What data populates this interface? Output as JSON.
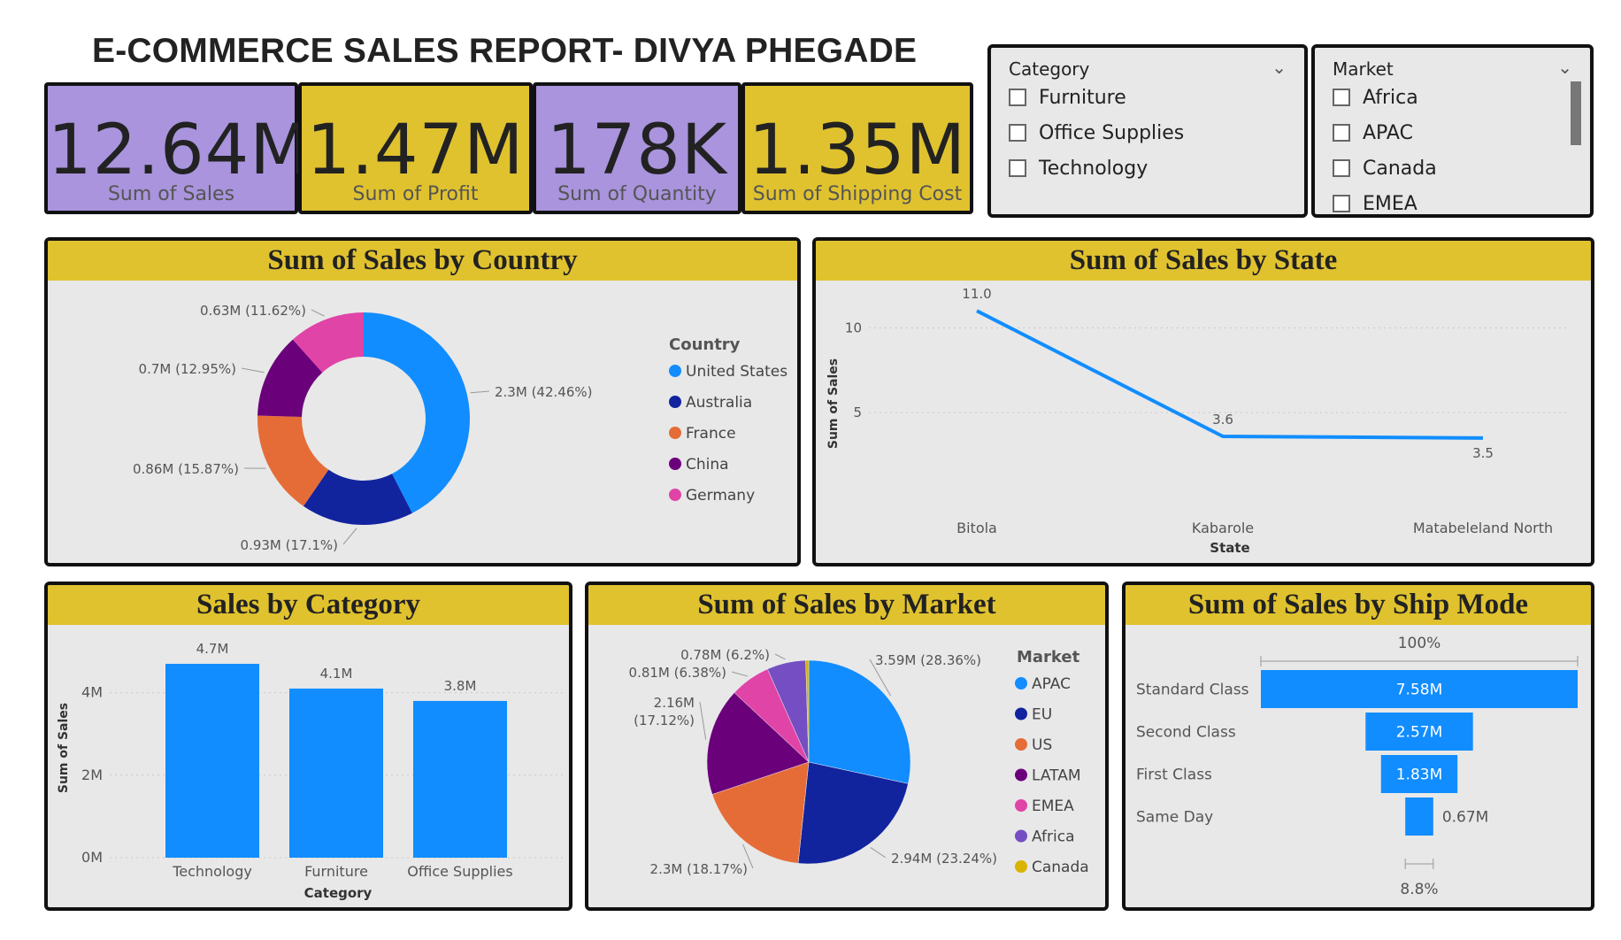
{
  "title": "E-COMMERCE SALES REPORT- DIVYA PHEGADE",
  "kpis": [
    {
      "value": "12.64M",
      "label": "Sum of Sales",
      "color": "#a994dd"
    },
    {
      "value": "1.47M",
      "label": "Sum of Profit",
      "color": "#e0c22f"
    },
    {
      "value": "178K",
      "label": "Sum of Quantity",
      "color": "#a994dd"
    },
    {
      "value": "1.35M",
      "label": "Sum of Shipping Cost",
      "color": "#e0c22f"
    }
  ],
  "slicers": {
    "category": {
      "header": "Category",
      "items": [
        "Furniture",
        "Office Supplies",
        "Technology"
      ]
    },
    "market": {
      "header": "Market",
      "items": [
        "Africa",
        "APAC",
        "Canada",
        "EMEA"
      ]
    }
  },
  "chart_data": [
    {
      "type": "pie",
      "variant": "donut",
      "title": "Sum of Sales by Country",
      "legend_title": "Country",
      "categories": [
        "United States",
        "Australia",
        "France",
        "China",
        "Germany"
      ],
      "values": [
        2.3,
        0.93,
        0.86,
        0.7,
        0.63
      ],
      "data_labels": [
        "2.3M (42.46%)",
        "0.93M (17.1%)",
        "0.86M (15.87%)",
        "0.7M (12.95%)",
        "0.63M (11.62%)"
      ],
      "colors": [
        "#118dff",
        "#12239e",
        "#e66c37",
        "#6b007b",
        "#e044a7"
      ],
      "legend_position": "right"
    },
    {
      "type": "line",
      "title": "Sum of Sales by State",
      "xlabel": "State",
      "ylabel": "Sum of Sales",
      "categories": [
        "Bitola",
        "Kabarole",
        "Matabeleland North"
      ],
      "values": [
        11.0,
        3.6,
        3.5
      ],
      "data_labels": [
        "11.0",
        "3.6",
        "3.5"
      ],
      "yticks": [
        5,
        10
      ],
      "ylim": [
        0,
        12
      ],
      "color": "#118dff"
    },
    {
      "type": "bar",
      "title": "Sales by Category",
      "xlabel": "Category",
      "ylabel": "Sum of Sales",
      "categories": [
        "Technology",
        "Furniture",
        "Office Supplies"
      ],
      "values": [
        4.7,
        4.1,
        3.8
      ],
      "data_labels": [
        "4.7M",
        "4.1M",
        "3.8M"
      ],
      "yticks": [
        "0M",
        "2M",
        "4M"
      ],
      "ylim": [
        0,
        5
      ],
      "color": "#118dff"
    },
    {
      "type": "pie",
      "title": "Sum of Sales by Market",
      "legend_title": "Market",
      "categories": [
        "APAC",
        "EU",
        "US",
        "LATAM",
        "EMEA",
        "Africa",
        "Canada"
      ],
      "values": [
        3.59,
        2.94,
        2.3,
        2.16,
        0.81,
        0.78,
        0.06
      ],
      "data_labels": [
        "3.59M (28.36%)",
        "2.94M (23.24%)",
        "2.3M (18.17%)",
        "2.16M",
        "0.81M (6.38%)",
        "0.78M (6.2%)",
        ""
      ],
      "data_label_extra": {
        "LATAM": "(17.12%)"
      },
      "colors": [
        "#118dff",
        "#12239e",
        "#e66c37",
        "#6b007b",
        "#e044a7",
        "#744ec2",
        "#d9b300"
      ],
      "legend_position": "right"
    },
    {
      "type": "bar",
      "variant": "funnel",
      "title": "Sum of Sales by Ship Mode",
      "categories": [
        "Standard Class",
        "Second Class",
        "First Class",
        "Same Day"
      ],
      "values": [
        7.58,
        2.57,
        1.83,
        0.67
      ],
      "data_labels": [
        "7.58M",
        "2.57M",
        "1.83M",
        "0.67M"
      ],
      "top_label": "100%",
      "bottom_label": "8.8%",
      "color": "#118dff"
    }
  ]
}
